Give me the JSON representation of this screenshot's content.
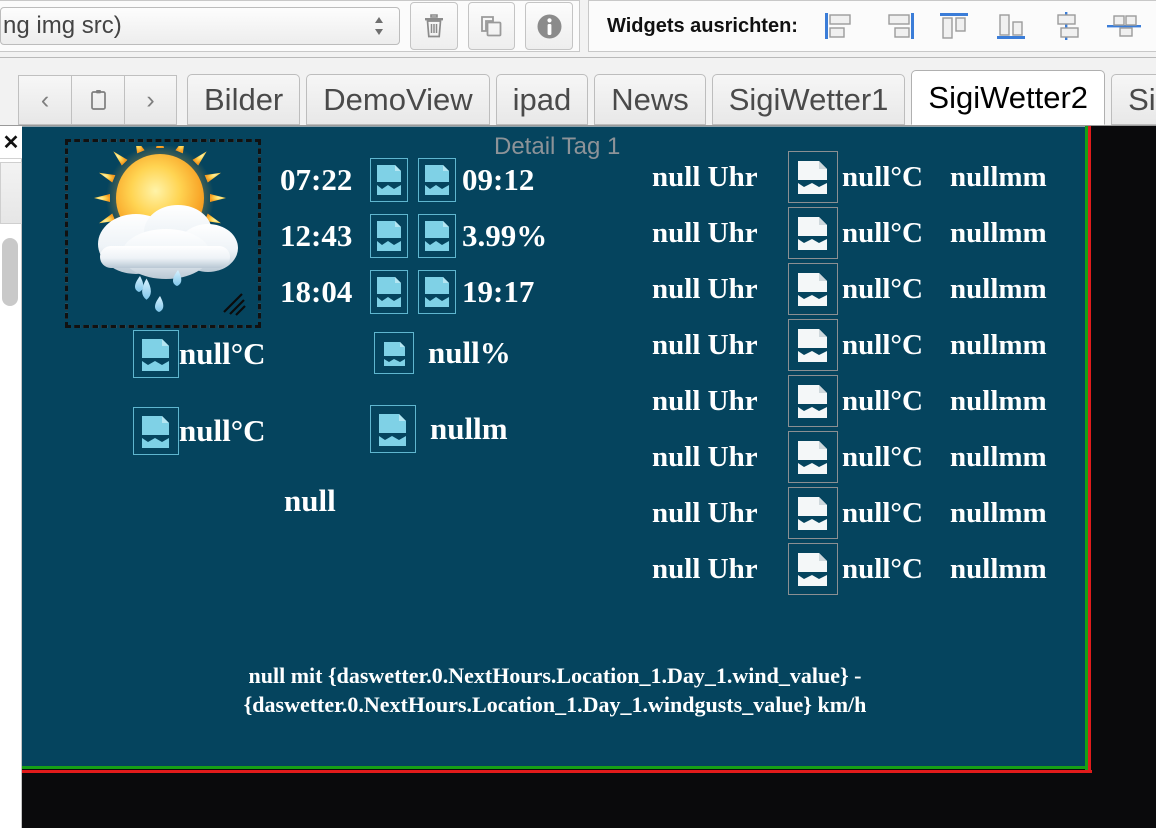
{
  "toolbar": {
    "source_select_value": "ng img src)",
    "source_select_placeholder": "ng img src)",
    "delete_label": "trash-icon",
    "duplicate_label": "copy-icon",
    "info_label": "info-icon",
    "align_label": "Widgets ausrichten:",
    "align_buttons": [
      "align-left",
      "align-right",
      "align-top",
      "align-bottom",
      "align-center-vertical",
      "align-center-horizontal"
    ]
  },
  "tabbar": {
    "nav_back": "‹",
    "nav_clipboard": "☐",
    "nav_forward": "›",
    "tabs": [
      {
        "label": "Bilder",
        "active": false
      },
      {
        "label": "DemoView",
        "active": false
      },
      {
        "label": "ipad",
        "active": false
      },
      {
        "label": "News",
        "active": false
      },
      {
        "label": "SigiWetter1",
        "active": false
      },
      {
        "label": "SigiWetter2",
        "active": true
      },
      {
        "label": "Sig",
        "active": false
      }
    ]
  },
  "left_panel": {
    "close_label": "✕"
  },
  "canvas": {
    "background_color": "#05445e",
    "guide_green": "#16a016",
    "guide_red": "#e01b1b",
    "title": "Detail Tag 1",
    "weather_image_name": "sun-behind-cloud-with-rain-icon"
  },
  "sun_rows": [
    {
      "left": "07:22",
      "right": "09:12"
    },
    {
      "left": "12:43",
      "right": "3.99%"
    },
    {
      "left": "18:04",
      "right": "19:17"
    }
  ],
  "stats": [
    {
      "name": "temperature-max",
      "value": "null°C"
    },
    {
      "name": "humidity",
      "value": "null%"
    },
    {
      "name": "temperature-min",
      "value": "null°C"
    },
    {
      "name": "precipitation-amount",
      "value": "nullm"
    },
    {
      "name": "condition-text",
      "value": "null"
    }
  ],
  "hours": [
    {
      "time": "null Uhr",
      "temp": "null°C",
      "rain": "nullmm"
    },
    {
      "time": "null Uhr",
      "temp": "null°C",
      "rain": "nullmm"
    },
    {
      "time": "null Uhr",
      "temp": "null°C",
      "rain": "nullmm"
    },
    {
      "time": "null Uhr",
      "temp": "null°C",
      "rain": "nullmm"
    },
    {
      "time": "null Uhr",
      "temp": "null°C",
      "rain": "nullmm"
    },
    {
      "time": "null Uhr",
      "temp": "null°C",
      "rain": "nullmm"
    },
    {
      "time": "null Uhr",
      "temp": "null°C",
      "rain": "nullmm"
    },
    {
      "time": "null Uhr",
      "temp": "null°C",
      "rain": "nullmm"
    }
  ],
  "wind": {
    "line1": "null mit {daswetter.0.NextHours.Location_1.Day_1.wind_value} -",
    "line2": "{daswetter.0.NextHours.Location_1.Day_1.windgusts_value} km/h"
  }
}
